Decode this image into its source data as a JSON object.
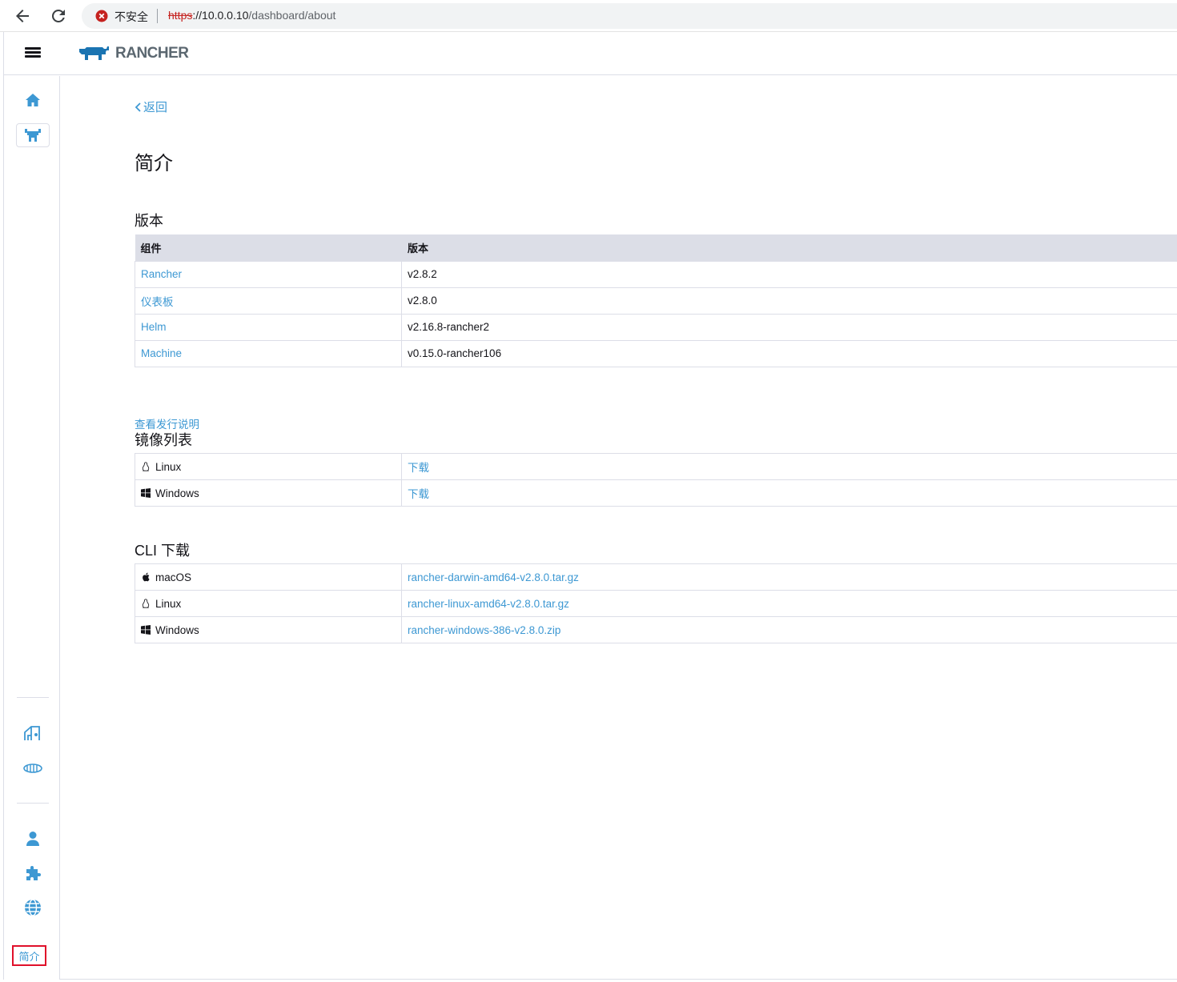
{
  "browser": {
    "security_label": "不安全",
    "url_scheme": "https",
    "url_host": "://10.0.0.10",
    "url_path": "/dashboard/about"
  },
  "header": {
    "brand": "RANCHER",
    "brand_color": "#1a74b2"
  },
  "sidebar": {
    "about_label": "简介",
    "accent_color": "#3d98d3",
    "items_top": [
      "home-icon",
      "cluster-icon"
    ],
    "items_mid": [
      "fleet-icon",
      "elemental-icon"
    ],
    "items_bottom": [
      "user-icon",
      "extensions-icon",
      "globe-icon"
    ]
  },
  "main": {
    "back_label": "返回",
    "title": "简介",
    "versions": {
      "title": "版本",
      "headers": [
        "组件",
        "版本"
      ],
      "rows": [
        {
          "component": "Rancher",
          "version": "v2.8.2"
        },
        {
          "component": "仪表板",
          "version": "v2.8.0"
        },
        {
          "component": "Helm",
          "version": "v2.16.8-rancher2"
        },
        {
          "component": "Machine",
          "version": "v0.15.0-rancher106"
        }
      ]
    },
    "release_notes_label": "查看发行说明",
    "images": {
      "title": "镜像列表",
      "rows": [
        {
          "os": "Linux",
          "icon": "linux-icon",
          "link": "下载"
        },
        {
          "os": "Windows",
          "icon": "windows-icon",
          "link": "下载"
        }
      ]
    },
    "cli": {
      "title": "CLI 下载",
      "rows": [
        {
          "os": "macOS",
          "icon": "apple-icon",
          "link": "rancher-darwin-amd64-v2.8.0.tar.gz"
        },
        {
          "os": "Linux",
          "icon": "linux-icon",
          "link": "rancher-linux-amd64-v2.8.0.tar.gz"
        },
        {
          "os": "Windows",
          "icon": "windows-icon",
          "link": "rancher-windows-386-v2.8.0.zip"
        }
      ]
    }
  }
}
